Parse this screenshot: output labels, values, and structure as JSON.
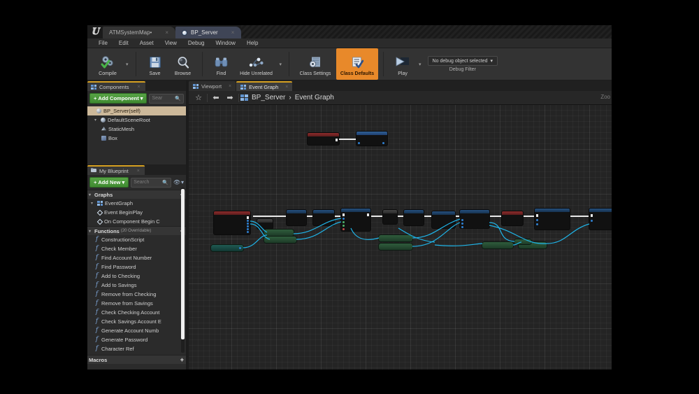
{
  "window": {
    "logo": "unreal-logo",
    "tabs": [
      {
        "label": "ATMSystemMap",
        "modified": "•",
        "active": false,
        "close": "×"
      },
      {
        "label": "BP_Server",
        "modified": "",
        "active": true,
        "close": "×"
      }
    ]
  },
  "menubar": {
    "items": [
      "File",
      "Edit",
      "Asset",
      "View",
      "Debug",
      "Window",
      "Help"
    ]
  },
  "toolbar": {
    "compile": {
      "label": "Compile",
      "icon": "compile-gears-check-icon",
      "dropdown": "▾"
    },
    "save": {
      "label": "Save",
      "icon": "floppy-disk-icon"
    },
    "browse": {
      "label": "Browse",
      "icon": "magnifier-icon"
    },
    "find": {
      "label": "Find",
      "icon": "binoculars-icon"
    },
    "hide_unrelated": {
      "label": "Hide Unrelated",
      "icon": "node-graph-icon",
      "dropdown": "▾"
    },
    "class_settings": {
      "label": "Class Settings",
      "icon": "gear-document-icon"
    },
    "class_defaults": {
      "label": "Class Defaults",
      "icon": "checklist-document-icon",
      "active": true
    },
    "play": {
      "label": "Play",
      "icon": "play-triangle-icon",
      "dropdown": "▾"
    },
    "debug_object": {
      "value": "No debug object selected",
      "caret": "▾"
    },
    "debug_filter_label": "Debug Filter"
  },
  "components_panel": {
    "tab_label": "Components",
    "tab_icon": "components-icon",
    "tab_close": "×",
    "add_component_label": "Add Component",
    "add_component_plus": "+",
    "add_component_caret": "▾",
    "search_placeholder": "Sear",
    "search_icon": "search-icon",
    "tree": [
      {
        "label": "BP_Server(self)",
        "icon": "blueprint-sphere-icon",
        "indent": 0,
        "selected": true,
        "arrow": ""
      },
      {
        "label": "DefaultSceneRoot",
        "icon": "scene-root-icon",
        "indent": 1,
        "selected": false,
        "arrow": "▾"
      },
      {
        "label": "StaticMesh",
        "icon": "static-mesh-icon",
        "indent": 2,
        "selected": false,
        "arrow": ""
      },
      {
        "label": "Box",
        "icon": "box-collision-icon",
        "indent": 2,
        "selected": false,
        "arrow": ""
      }
    ]
  },
  "my_blueprint_panel": {
    "tab_label": "My Blueprint",
    "tab_icon": "blueprint-icon",
    "tab_close": "×",
    "add_new_label": "Add New",
    "add_new_plus": "+",
    "add_new_caret": "▾",
    "search_placeholder": "Search",
    "search_icon": "search-icon",
    "eye_icon": "eye-icon",
    "eye_caret": "▾",
    "sections": [
      {
        "title": "Graphs",
        "subtitle": "",
        "plus": "+",
        "items": [
          {
            "label": "EventGraph",
            "icon": "event-graph-icon",
            "indent": 1,
            "arrow": "▾"
          },
          {
            "label": "Event BeginPlay",
            "icon": "event-node-icon",
            "indent": 2,
            "arrow": ""
          },
          {
            "label": "On Component Begin C",
            "icon": "event-node-icon",
            "indent": 2,
            "arrow": ""
          }
        ]
      },
      {
        "title": "Functions",
        "subtitle": "(20 Overridable)",
        "plus": "+",
        "items": [
          {
            "label": "ConstructionScript",
            "icon": "construction-script-icon",
            "indent": 3,
            "arrow": ""
          },
          {
            "label": "Check Member",
            "icon": "function-icon",
            "indent": 3,
            "arrow": ""
          },
          {
            "label": "Find Account Number",
            "icon": "function-icon",
            "indent": 3,
            "arrow": ""
          },
          {
            "label": "Find Password",
            "icon": "function-icon",
            "indent": 3,
            "arrow": ""
          },
          {
            "label": "Add to Checking",
            "icon": "function-icon",
            "indent": 3,
            "arrow": ""
          },
          {
            "label": "Add to Savings",
            "icon": "function-icon",
            "indent": 3,
            "arrow": ""
          },
          {
            "label": "Remove from Checking",
            "icon": "function-icon",
            "indent": 3,
            "arrow": ""
          },
          {
            "label": "Remove from Savings",
            "icon": "function-icon",
            "indent": 3,
            "arrow": ""
          },
          {
            "label": "Check Checking Account",
            "icon": "function-icon",
            "indent": 3,
            "arrow": ""
          },
          {
            "label": "Check Savings Account E",
            "icon": "function-icon",
            "indent": 3,
            "arrow": ""
          },
          {
            "label": "Generate Account Numb",
            "icon": "function-icon",
            "indent": 3,
            "arrow": ""
          },
          {
            "label": "Generate Password",
            "icon": "function-icon",
            "indent": 3,
            "arrow": ""
          },
          {
            "label": "Character Ref",
            "icon": "function-icon",
            "indent": 3,
            "arrow": ""
          }
        ]
      },
      {
        "title": "Macros",
        "subtitle": "",
        "plus": "+",
        "items": []
      }
    ]
  },
  "graph_area": {
    "tabs": [
      {
        "label": "Viewport",
        "icon": "viewport-icon",
        "active": false,
        "close": "×"
      },
      {
        "label": "Event Graph",
        "icon": "event-graph-icon",
        "active": true,
        "close": "×"
      }
    ],
    "favorite_icon": "star-icon",
    "back_icon": "arrow-left-icon",
    "forward_icon": "arrow-right-icon",
    "breadcrumb_icon": "event-graph-icon",
    "breadcrumb": [
      "BP_Server",
      "Event Graph"
    ],
    "breadcrumb_sep": "›",
    "zoom_label": "Zoo"
  }
}
